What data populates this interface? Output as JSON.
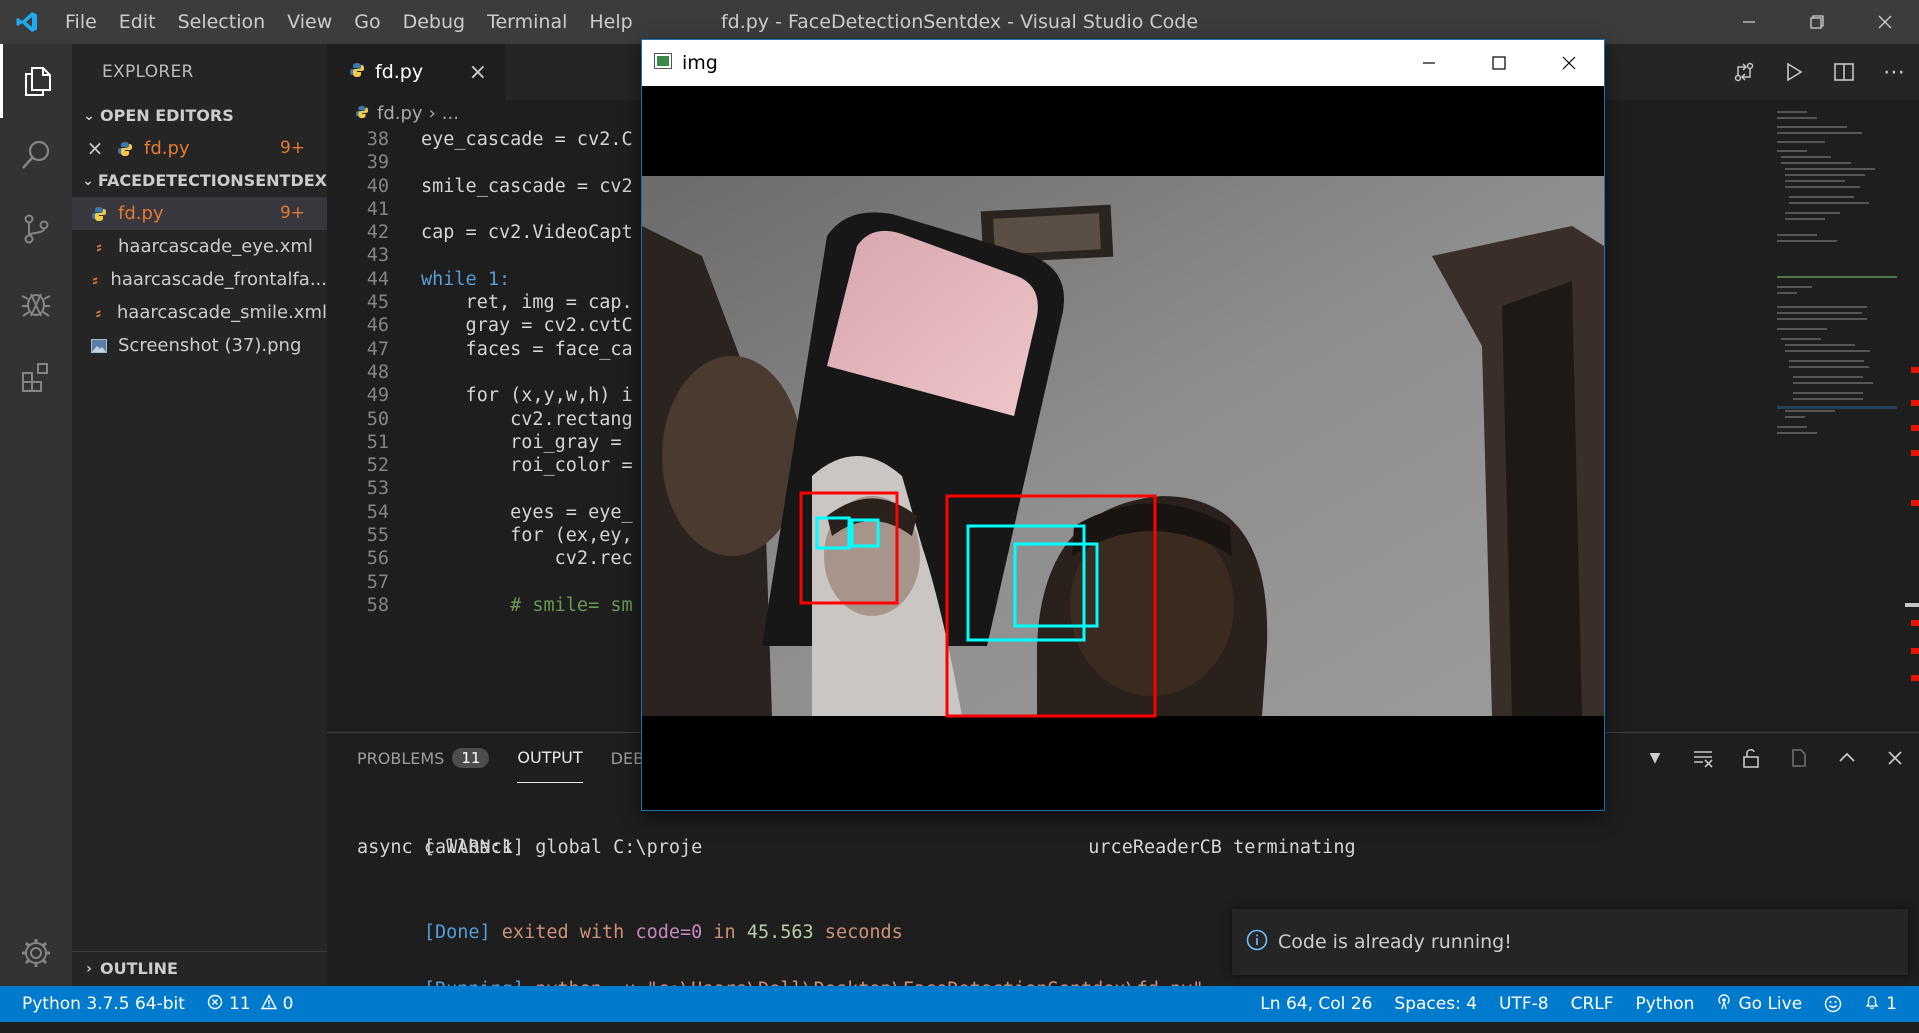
{
  "titlebar": {
    "menu": [
      "File",
      "Edit",
      "Selection",
      "View",
      "Go",
      "Debug",
      "Terminal",
      "Help"
    ],
    "title": "fd.py - FaceDetectionSentdex - Visual Studio Code"
  },
  "sidebar": {
    "header": "EXPLORER",
    "open_editors": "OPEN EDITORS",
    "open_file": {
      "name": "fd.py",
      "badge": "9+"
    },
    "folder": "FACEDETECTIONSENTDEX",
    "files": [
      {
        "name": "fd.py",
        "badge": "9+",
        "icon": "python-file-icon"
      },
      {
        "name": "haarcascade_eye.xml",
        "badge": "",
        "icon": "xml-file-icon"
      },
      {
        "name": "haarcascade_frontalfa...",
        "badge": "",
        "icon": "xml-file-icon"
      },
      {
        "name": "haarcascade_smile.xml",
        "badge": "",
        "icon": "xml-file-icon"
      },
      {
        "name": "Screenshot (37).png",
        "badge": "",
        "icon": "image-file-icon"
      }
    ],
    "outline": "OUTLINE"
  },
  "editor": {
    "tab_label": "fd.py",
    "breadcrumb_file": "fd.py",
    "breadcrumb_rest": "...",
    "lines": [
      {
        "n": "38",
        "t": "eye_cascade = cv2.C"
      },
      {
        "n": "39",
        "t": ""
      },
      {
        "n": "40",
        "t": "smile_cascade = cv2"
      },
      {
        "n": "41",
        "t": ""
      },
      {
        "n": "42",
        "t": "cap = cv2.VideoCapt"
      },
      {
        "n": "43",
        "t": ""
      },
      {
        "n": "44",
        "t": "while 1:"
      },
      {
        "n": "45",
        "t": "    ret, img = cap."
      },
      {
        "n": "46",
        "t": "    gray = cv2.cvtC"
      },
      {
        "n": "47",
        "t": "    faces = face_ca"
      },
      {
        "n": "48",
        "t": ""
      },
      {
        "n": "49",
        "t": "    for (x,y,w,h) i"
      },
      {
        "n": "50",
        "t": "        cv2.rectang"
      },
      {
        "n": "51",
        "t": "        roi_gray ="
      },
      {
        "n": "52",
        "t": "        roi_color ="
      },
      {
        "n": "53",
        "t": ""
      },
      {
        "n": "54",
        "t": "        eyes = eye_"
      },
      {
        "n": "55",
        "t": "        for (ex,ey,"
      },
      {
        "n": "56",
        "t": "            cv2.rec"
      },
      {
        "n": "57",
        "t": ""
      },
      {
        "n": "58",
        "t": "        # smile= sm"
      }
    ]
  },
  "panel": {
    "tabs": [
      {
        "label": "PROBLEMS",
        "count": "11"
      },
      {
        "label": "OUTPUT",
        "count": ""
      },
      {
        "label": "DEBU",
        "count": ""
      }
    ],
    "output": {
      "warn_prefix": "[ WARN:1] global C:\\proje",
      "warn_suffix": "urceReaderCB terminating",
      "async": "async callback",
      "done_tag": "[Done]",
      "done_text_a": " exited with ",
      "done_code": "code=0",
      "done_text_b": " in ",
      "done_secs": "45.563",
      "done_text_c": " seconds",
      "running_tag": "[Running]",
      "running_cmd": " python -u \"c:\\Users\\Dell\\Desktop\\FaceDetectionSentdex\\fd.py\""
    },
    "toast": "Code is already running!"
  },
  "statusbar": {
    "python": "Python 3.7.5 64-bit",
    "errors": "11",
    "warnings": "0",
    "position": "Ln 64, Col 26",
    "spaces": "Spaces: 4",
    "encoding": "UTF-8",
    "eol": "CRLF",
    "language": "Python",
    "golive": "Go Live",
    "notifications": "1"
  },
  "imgwin": {
    "title": "img"
  },
  "colors": {
    "accent": "#007acc",
    "face_box": "#ff0000",
    "eye_box": "#00ffff"
  }
}
